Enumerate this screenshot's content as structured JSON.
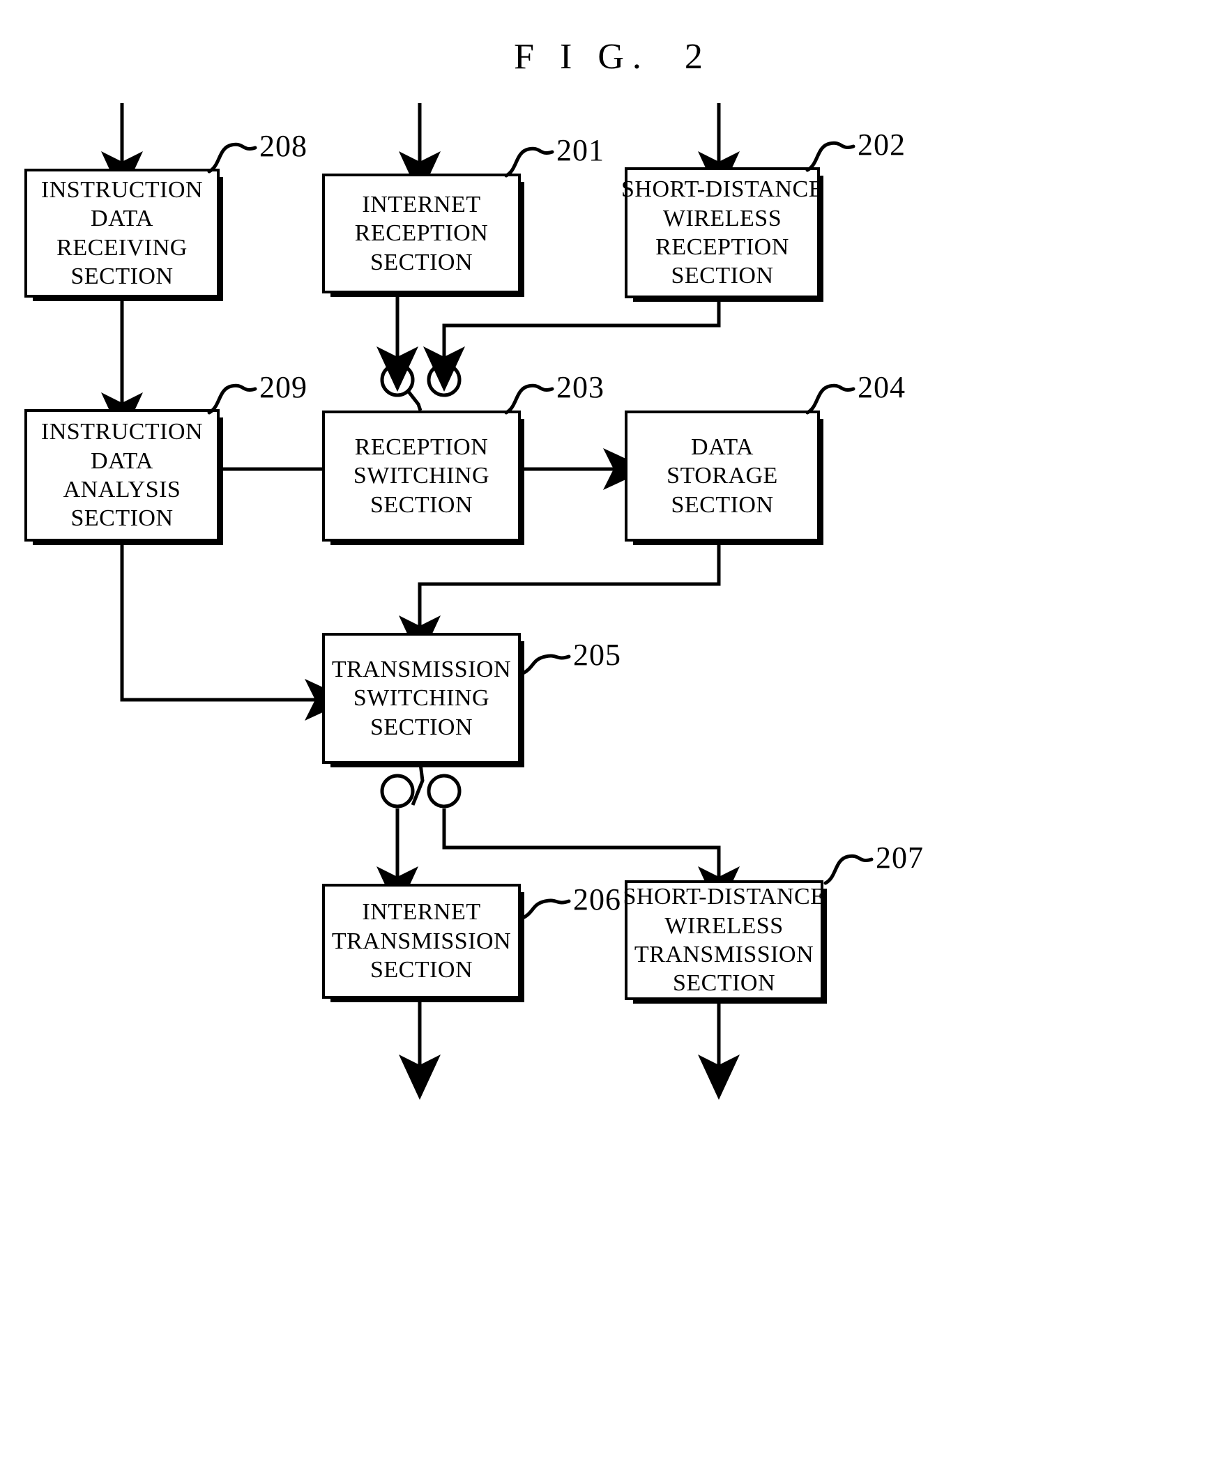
{
  "figure": {
    "title": "F I G.  2"
  },
  "nodes": [
    {
      "id": "n208",
      "ref": "208",
      "lines": [
        "INSTRUCTION",
        "DATA",
        "RECEIVING",
        "SECTION"
      ]
    },
    {
      "id": "n201",
      "ref": "201",
      "lines": [
        "INTERNET",
        "RECEPTION",
        "SECTION"
      ]
    },
    {
      "id": "n202",
      "ref": "202",
      "lines": [
        "SHORT-DISTANCE",
        "WIRELESS",
        "RECEPTION",
        "SECTION"
      ]
    },
    {
      "id": "n209",
      "ref": "209",
      "lines": [
        "INSTRUCTION",
        "DATA",
        "ANALYSIS",
        "SECTION"
      ]
    },
    {
      "id": "n203",
      "ref": "203",
      "lines": [
        "RECEPTION",
        "SWITCHING",
        "SECTION"
      ]
    },
    {
      "id": "n204",
      "ref": "204",
      "lines": [
        "DATA",
        "STORAGE",
        "SECTION"
      ]
    },
    {
      "id": "n205",
      "ref": "205",
      "lines": [
        "TRANSMISSION",
        "SWITCHING",
        "SECTION"
      ]
    },
    {
      "id": "n206",
      "ref": "206",
      "lines": [
        "INTERNET",
        "TRANSMISSION",
        "SECTION"
      ]
    },
    {
      "id": "n207",
      "ref": "207",
      "lines": [
        "SHORT-DISTANCE",
        "WIRELESS",
        "TRANSMISSION",
        "SECTION"
      ]
    }
  ],
  "colors": {
    "ink": "#000000",
    "paper": "#ffffff"
  }
}
